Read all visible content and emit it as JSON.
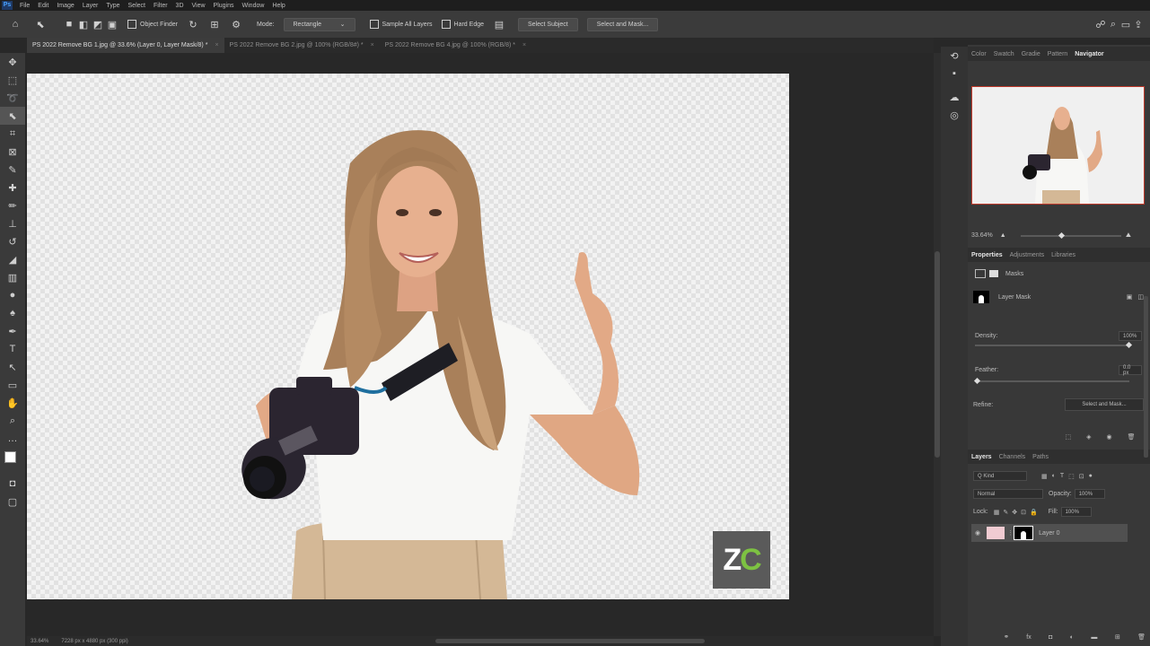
{
  "menu": {
    "items": [
      "File",
      "Edit",
      "Image",
      "Layer",
      "Type",
      "Select",
      "Filter",
      "3D",
      "View",
      "Plugins",
      "Window",
      "Help"
    ]
  },
  "options_bar": {
    "object_finder_label": "Object Finder",
    "mode_label": "Mode:",
    "mode_value": "Rectangle",
    "sample_all_layers_label": "Sample All Layers",
    "hard_edge_label": "Hard Edge",
    "select_subject_label": "Select Subject",
    "select_and_mask_label": "Select and Mask..."
  },
  "tabs": [
    {
      "label": "PS 2022 Remove BG 1.jpg @ 33.6% (Layer 0, Layer Mask/8) *",
      "active": true
    },
    {
      "label": "PS 2022 Remove BG 2.jpg @ 100% (RGB/8#) *",
      "active": false
    },
    {
      "label": "PS 2022 Remove BG 4.jpg @ 100% (RGB/8) *",
      "active": false
    }
  ],
  "logo": {
    "text_main": "ZC",
    "accent_color": "#7dc242"
  },
  "panel_tabs_top": [
    "Color",
    "Swatch",
    "Gradie",
    "Pattern",
    "Navigator"
  ],
  "navigator": {
    "zoom": "33.64%"
  },
  "properties": {
    "tabs": [
      "Properties",
      "Adjustments",
      "Libraries"
    ],
    "section_label": "Masks",
    "layer_mask_label": "Layer Mask",
    "density_label": "Density:",
    "density_value": "100%",
    "feather_label": "Feather:",
    "feather_value": "0.0 px",
    "refine_label": "Refine:",
    "select_and_mask_label": "Select and Mask..."
  },
  "layers": {
    "tabs": [
      "Layers",
      "Channels",
      "Paths"
    ],
    "kind_label": "Q Kind",
    "blend_mode": "Normal",
    "opacity_label": "Opacity:",
    "opacity_value": "100%",
    "lock_label": "Lock:",
    "fill_label": "Fill:",
    "fill_value": "100%",
    "layer_name": "Layer 0"
  },
  "status": {
    "zoom": "33.64%",
    "doc_size": "7228 px x 4880 px (300 ppi)"
  },
  "colors": {
    "canvas_bg": "#f2f2f2",
    "ui_dark": "#282828",
    "panel": "#383838"
  }
}
